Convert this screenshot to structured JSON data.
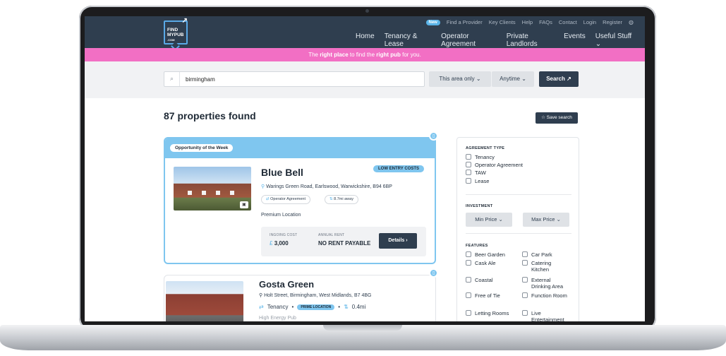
{
  "utility_nav": {
    "new_badge": "New",
    "items": [
      "Find a Provider",
      "Key Clients",
      "Help",
      "FAQs",
      "Contact",
      "Login",
      "Register"
    ]
  },
  "logo": {
    "line1": "FIND",
    "line2": "MYPUB",
    "line3": ".COM"
  },
  "main_nav": {
    "items": [
      "Home",
      "Tenancy & Lease",
      "Operator Agreement",
      "Private Landlords",
      "Events",
      "Useful Stuff ⌄"
    ]
  },
  "banner": {
    "part1": "The ",
    "bold1": "right place",
    "part2": " to find the ",
    "bold2": "right pub",
    "part3": " for you."
  },
  "search": {
    "value": "birmingham",
    "area_label": "This area only ⌄",
    "time_label": "Anytime ⌄",
    "button_label": "Search ↗"
  },
  "results": {
    "title": "87 properties found",
    "save_label": "☆ Save search"
  },
  "card1": {
    "ribbon": "Opportunity of the Week",
    "name": "Blue Bell",
    "tag": "LOW ENTRY COSTS",
    "address": "Warings Green Road, Earlswood, Warwickshire, B94 6BP",
    "chip_type": "Operator Agreement",
    "chip_distance": "8.7mi away",
    "premium": "Premium Location",
    "ingoing_label": "INGOING COST",
    "ingoing_currency": "£",
    "ingoing_value": "3,000",
    "rent_label": "ANNUAL RENT",
    "rent_value": "NO RENT PAYABLE",
    "details_label": "Details ›"
  },
  "card2": {
    "name": "Gosta Green",
    "address": "Holt Street, Birmingham, West Midlands, B7 4BG",
    "type": "Tenancy",
    "tag": "PRIME LOCATION",
    "distance": "0.4mi",
    "note": "High Energy Pub"
  },
  "filters": {
    "agreement_heading": "AGREEMENT TYPE",
    "agreement_options": [
      "Tenancy",
      "Operator Agreement",
      "TAW",
      "Lease"
    ],
    "investment_heading": "INVESTMENT",
    "min_price": "Min Price ⌄",
    "max_price": "Max Price ⌄",
    "features_heading": "FEATURES",
    "features_left": [
      "Beer Garden",
      "Cask Ale",
      "Coastal",
      "Free of Tie",
      "Letting Rooms"
    ],
    "features_right": [
      "Car Park",
      "Catering Kitchen",
      "External Drinking Area",
      "Function Room",
      "Live Entertainment"
    ]
  }
}
